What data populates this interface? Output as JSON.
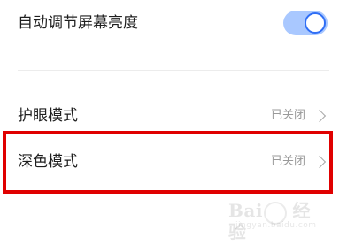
{
  "settings": {
    "auto_brightness": {
      "label": "自动调节屏幕亮度",
      "enabled": true
    },
    "eye_protection": {
      "label": "护眼模式",
      "value": "已关闭"
    },
    "dark_mode": {
      "label": "深色模式",
      "value": "已关闭"
    }
  },
  "highlight": {
    "color": "#e00000",
    "target": "dark_mode"
  },
  "watermark": {
    "text": "Bai",
    "text2": "经验",
    "sub": "jingyan.baidu.com"
  },
  "colors": {
    "toggle_track": "#a9c8ff",
    "toggle_knob_border": "#2f6ef5",
    "value_text": "#9a9a9a"
  }
}
